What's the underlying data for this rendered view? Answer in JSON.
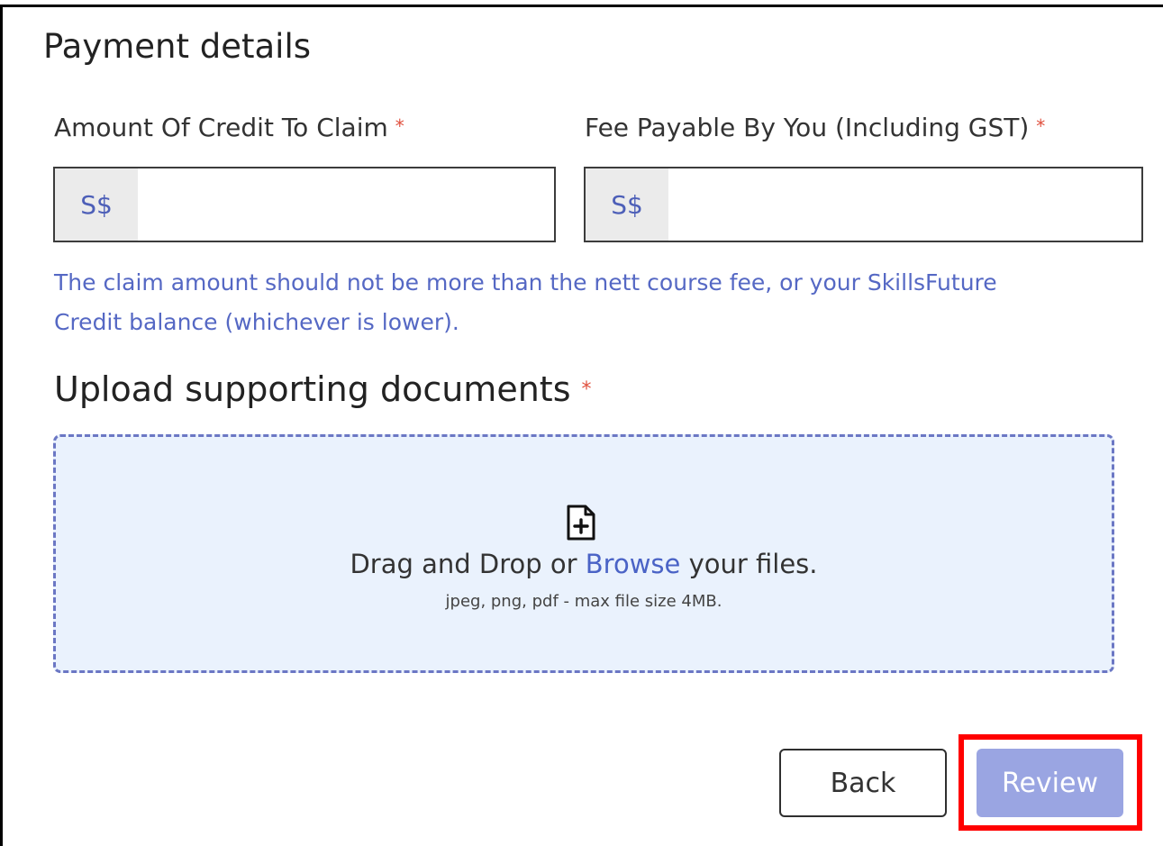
{
  "section": {
    "title": "Payment details"
  },
  "fields": {
    "credit": {
      "label": "Amount Of Credit To Claim",
      "required_mark": "*",
      "prefix": "S$",
      "value": ""
    },
    "fee": {
      "label": "Fee Payable By You (Including GST)",
      "required_mark": "*",
      "prefix": "S$",
      "value": ""
    },
    "hint": "The claim amount should not be more than the nett course fee, or your SkillsFuture Credit balance (whichever is lower)."
  },
  "upload": {
    "title": "Upload supporting documents",
    "required_mark": "*",
    "drop_text_before": "Drag and Drop or ",
    "browse_link": "Browse",
    "drop_text_after": " your files.",
    "file_types": "jpeg, png, pdf - max file size 4MB.",
    "icon": "file-plus-icon"
  },
  "actions": {
    "back_label": "Back",
    "review_label": "Review"
  },
  "colors": {
    "accent": "#4a63c6",
    "hint": "#5568c4",
    "required": "#e0503e",
    "dropzone_bg": "#eaf2fd",
    "dropzone_border": "#6b77c4",
    "review_button": "#9aa5e2",
    "highlight": "#ff0000"
  }
}
